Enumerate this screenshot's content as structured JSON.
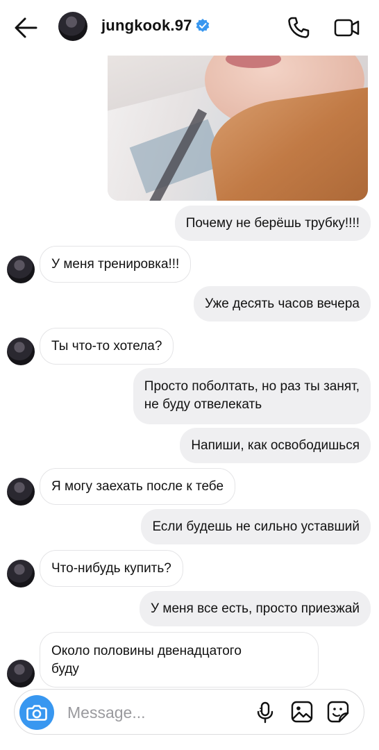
{
  "header": {
    "username": "jungkook.97",
    "icons": [
      "back-arrow-icon",
      "verified-badge-icon",
      "phone-icon",
      "video-camera-icon"
    ]
  },
  "colors": {
    "accent": "#3897f0",
    "outgoing_bubble": "#efeff1",
    "incoming_border": "#e4e4e6"
  },
  "messages": [
    {
      "direction": "outgoing",
      "text": "Почему не берёшь трубку!!!!"
    },
    {
      "direction": "incoming",
      "text": "У меня тренировка!!!"
    },
    {
      "direction": "outgoing",
      "text": "Уже десять часов вечера"
    },
    {
      "direction": "incoming",
      "text": "Ты что-то хотела?"
    },
    {
      "direction": "outgoing",
      "text_line1": "Просто поболтать, но раз ты занят,",
      "text_line2": "не буду отвелекать"
    },
    {
      "direction": "outgoing",
      "text": "Напиши, как освободишься"
    },
    {
      "direction": "incoming",
      "text": "Я могу заехать после к тебе"
    },
    {
      "direction": "outgoing",
      "text": "Если будешь не сильно уставший"
    },
    {
      "direction": "incoming",
      "text": "Что-нибудь купить?"
    },
    {
      "direction": "outgoing",
      "text": "У меня все есть, просто приезжай"
    },
    {
      "direction": "incoming",
      "text_line1": "Около половины двенадцатого",
      "text_line2": "буду"
    }
  ],
  "composer": {
    "placeholder": "Message...",
    "icons": [
      "camera-icon",
      "microphone-icon",
      "gallery-icon",
      "sticker-icon"
    ]
  }
}
